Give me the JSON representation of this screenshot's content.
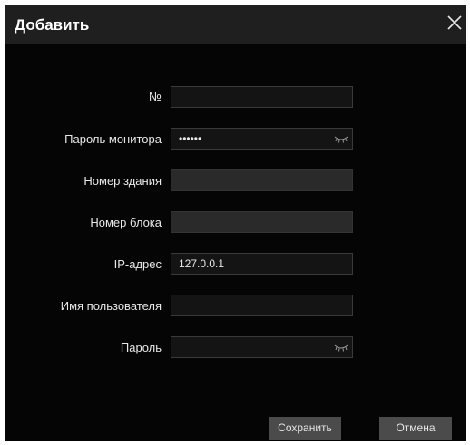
{
  "dialog": {
    "title": "Добавить",
    "close_icon": "close-icon"
  },
  "form": {
    "number": {
      "label": "№",
      "value": ""
    },
    "monitor_password": {
      "label": "Пароль монитора",
      "value": "••••••",
      "icon": "eye-closed-icon"
    },
    "building_number": {
      "label": "Номер здания",
      "value": ""
    },
    "block_number": {
      "label": "Номер блока",
      "value": ""
    },
    "ip_address": {
      "label": "IP-адрес",
      "value": "127.0.0.1"
    },
    "username": {
      "label": "Имя пользователя",
      "value": ""
    },
    "password": {
      "label": "Пароль",
      "value": "",
      "icon": "eye-closed-icon"
    }
  },
  "buttons": {
    "save": "Сохранить",
    "cancel": "Отмена"
  }
}
